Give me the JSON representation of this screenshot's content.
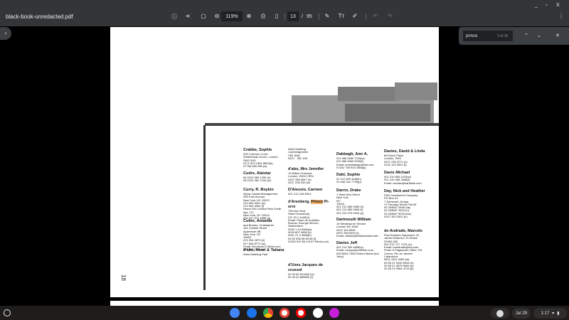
{
  "window": {
    "title": "black-book-unredacted.pdf",
    "minimize": "_",
    "maximize": "▫",
    "close": "X"
  },
  "toolbar": {
    "zoom": "119%",
    "page_current": "13",
    "page_sep": "/",
    "page_total": "95",
    "more": "⋮"
  },
  "find": {
    "query": "prince",
    "count": "2 of 15"
  },
  "page": {
    "number": "18",
    "entries": [
      {
        "name": "Crabbe, Sophie",
        "lines": [
          "325 Cranmer Court",
          "Whiteheads Grove, London",
          "SW3 3HD",
          "0171 823 1581 8620(h)",
          "07768 358 288 (w)"
        ]
      },
      {
        "name": "Cudre, Alaistar",
        "lines": [
          "06 0310 369 4780 (h)",
          "06 0314 282 1234 (w)"
        ]
      },
      {
        "name": "Curry, R. Boykin",
        "lines": [
          "Alpha Capital Management",
          "499 Park Avenue",
          "New York, NY 10022",
          "212 605 4001 (w)",
          "212 605 4004 (f)",
          "Home:240 Central Park South",
          "Apt. 17L",
          "New York, NY 10019",
          "001 917 972 4858 (p)"
        ]
      },
      {
        "name": "Cutter, Amanda",
        "lines": [
          "and Brooks, Christopher",
          "181 Christie Street",
          "Apartment 5B",
          "New York, NY",
          "10002",
          "212 254 2873 (h)",
          "917 846 8772 (w)",
          "Email: Brooksmc17@aol.com",
          "917 805 1667 (w)"
        ]
      },
      {
        "name": "d'abo, Henri & Tatiana",
        "lines": [
          "West Wratting Park"
        ]
      },
      {
        "name": "",
        "lines": [
          "West Wratting",
          "Cambridgeshire",
          "CB1 5NA",
          "0207 - 351 155"
        ]
      },
      {
        "name": "d'abo, Mrs Jennifer",
        "lines": [
          "13 Milton Crescent",
          "London, SW10 0RN",
          "0207 286 0647 (h)",
          "0207 236 039 (w)"
        ]
      },
      {
        "name": "D'Alessio, Carmen",
        "lines": [
          "001 212 249 8914"
        ]
      },
      {
        "name_pre": "d'Arenberg, ",
        "name_hl": "Prince",
        "name_post": " Pi-erre",
        "lines": [
          "735 rest Vinal",
          "Saint Germain(h)",
          "011 33 1 4449(h)",
          "Email: Place de la Belles",
          "Bureau: Bourgie Mexico",
          "Switzerland",
          "0033 1 42 8466(w)",
          "0033 607 9456 (h)",
          "0041 21 9 4666(h)",
          "00 52 556 68 85 68 (f)",
          "01152 519 56 10197 Mexico (w)"
        ]
      },
      {
        "name": "d'Uzes Jacques de crussol",
        "lines": [
          "00 33 60 521660 (w)",
          "00 33 42 885855 (f)"
        ]
      },
      {
        "name": "Dabbagh, Amr A.",
        "lines": [
          "011 966 2660 7220(w)",
          "011 966 2660 9000(f)",
          "Email: amrdabbagh@aol.com",
          "07442 738 933 3368(p)"
        ]
      },
      {
        "name": "Dahl, Sophie",
        "lines": [
          "01 212 829 4480(h)",
          "01 646 344 7730(p)"
        ]
      },
      {
        "name": "Darrin, Drake",
        "lines": [
          "1 West 81st Street",
          "New York",
          "NY",
          "10024",
          "001 212 580 0555 (h)",
          "001 212 580 0565 (f)",
          "001 310 275 0943 (p)"
        ]
      },
      {
        "name": "Dartmouth William",
        "lines": [
          "16 Westbourne Terrace",
          "London W2 3UW",
          "0207 402 8090",
          "0207 298 8449 (f)",
          "Email: william@williamdartmouth..."
        ]
      },
      {
        "name": "Davies Jeff",
        "lines": [
          "001 213 260 4698(w)",
          "Email: meeps@earthlink.com",
          "818 5634 7355 Robert Marini (ext",
          "Jeep)"
        ]
      },
      {
        "name": "Davies, David & Linda",
        "lines": [
          "86 Eaton Place",
          "London, SW1",
          "0207 235 2271 (h)",
          "0120 120 2601 (f)"
        ]
      },
      {
        "name": "Davis Michael",
        "lines": [
          "001 310 583 2215(w)",
          "001 310 398 2848(f)",
          "Email: micdav@earthlink.com"
        ]
      },
      {
        "name": "Day, Nick and Heather",
        "lines": [
          "P&D Investment Company",
          "PO Box 24",
          "7 Somerset, Kenya",
          "17 Faraday Street Flat #5",
          "00 254667 0466 Day",
          "00 254667 3400 (h)",
          "00 254667 5026 (fax)",
          "0207 352 2502 (h)"
        ]
      },
      {
        "name": "de Andrade, Marcelo",
        "lines": [
          "Rua Euclides Figueiredo 19",
          "Jardim Botanico, RJ Brazil",
          "22460-030",
          "001 212 717 7129 (w)",
          "Email: mandrade@aol.com",
          "Ponte 5 Pagadores Office 704",
          "Centro, Rio de Janeiro",
          "Catanduva",
          "5521 2511 9406 (w)",
          "00 55 21 3206 6006 (h)",
          "00 55 21 3879 8484 (p)",
          "00 55 21 9984 4716 (p)"
        ]
      }
    ]
  },
  "shelf": {
    "date": "Jul 29",
    "time": "1:17"
  }
}
